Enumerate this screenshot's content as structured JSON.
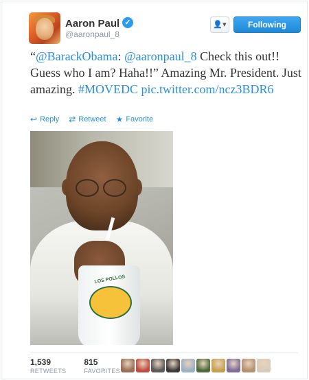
{
  "user": {
    "name": "Aaron Paul",
    "handle": "@aaronpaul_8"
  },
  "buttons": {
    "user_menu": "👤▾",
    "follow": "Following"
  },
  "tweet": {
    "text_parts": [
      {
        "text": "“",
        "link": false
      },
      {
        "text": "@BarackObama",
        "link": true
      },
      {
        "text": ": ",
        "link": false
      },
      {
        "text": "@aaronpaul_8",
        "link": true
      },
      {
        "text": " Check this out!! Guess who I am? Haha!!” Amazing Mr. President. Just amazing. ",
        "link": false
      },
      {
        "text": "#MOVEDC",
        "link": true
      },
      {
        "text": " ",
        "link": false
      },
      {
        "text": "pic.twitter.com/ncz3BDR6",
        "link": true
      }
    ],
    "actions": {
      "reply": "Reply",
      "retweet": "Retweet",
      "favorite": "Favorite"
    },
    "photo": {
      "cup_text": "LOS POLLOS"
    }
  },
  "stats": {
    "retweets_count": "1,539",
    "retweets_label": "RETWEETS",
    "favorites_count": "815",
    "favorites_label": "FAVORITES"
  },
  "favoriters": [
    {
      "color": "#9a6e57"
    },
    {
      "color": "#c04b3f"
    },
    {
      "color": "#5a5a5a"
    },
    {
      "color": "#3b3b3b"
    },
    {
      "color": "#9bb0c4"
    },
    {
      "color": "#4c6a3a"
    },
    {
      "color": "#c8a04d"
    },
    {
      "color": "#7e6c9a"
    },
    {
      "color": "#b4916f"
    },
    {
      "color": "#d8cbbb"
    }
  ],
  "colors": {
    "link": "#2a8fd9",
    "verified": "#2b9ceb",
    "follow_button": "#1f89d6"
  }
}
